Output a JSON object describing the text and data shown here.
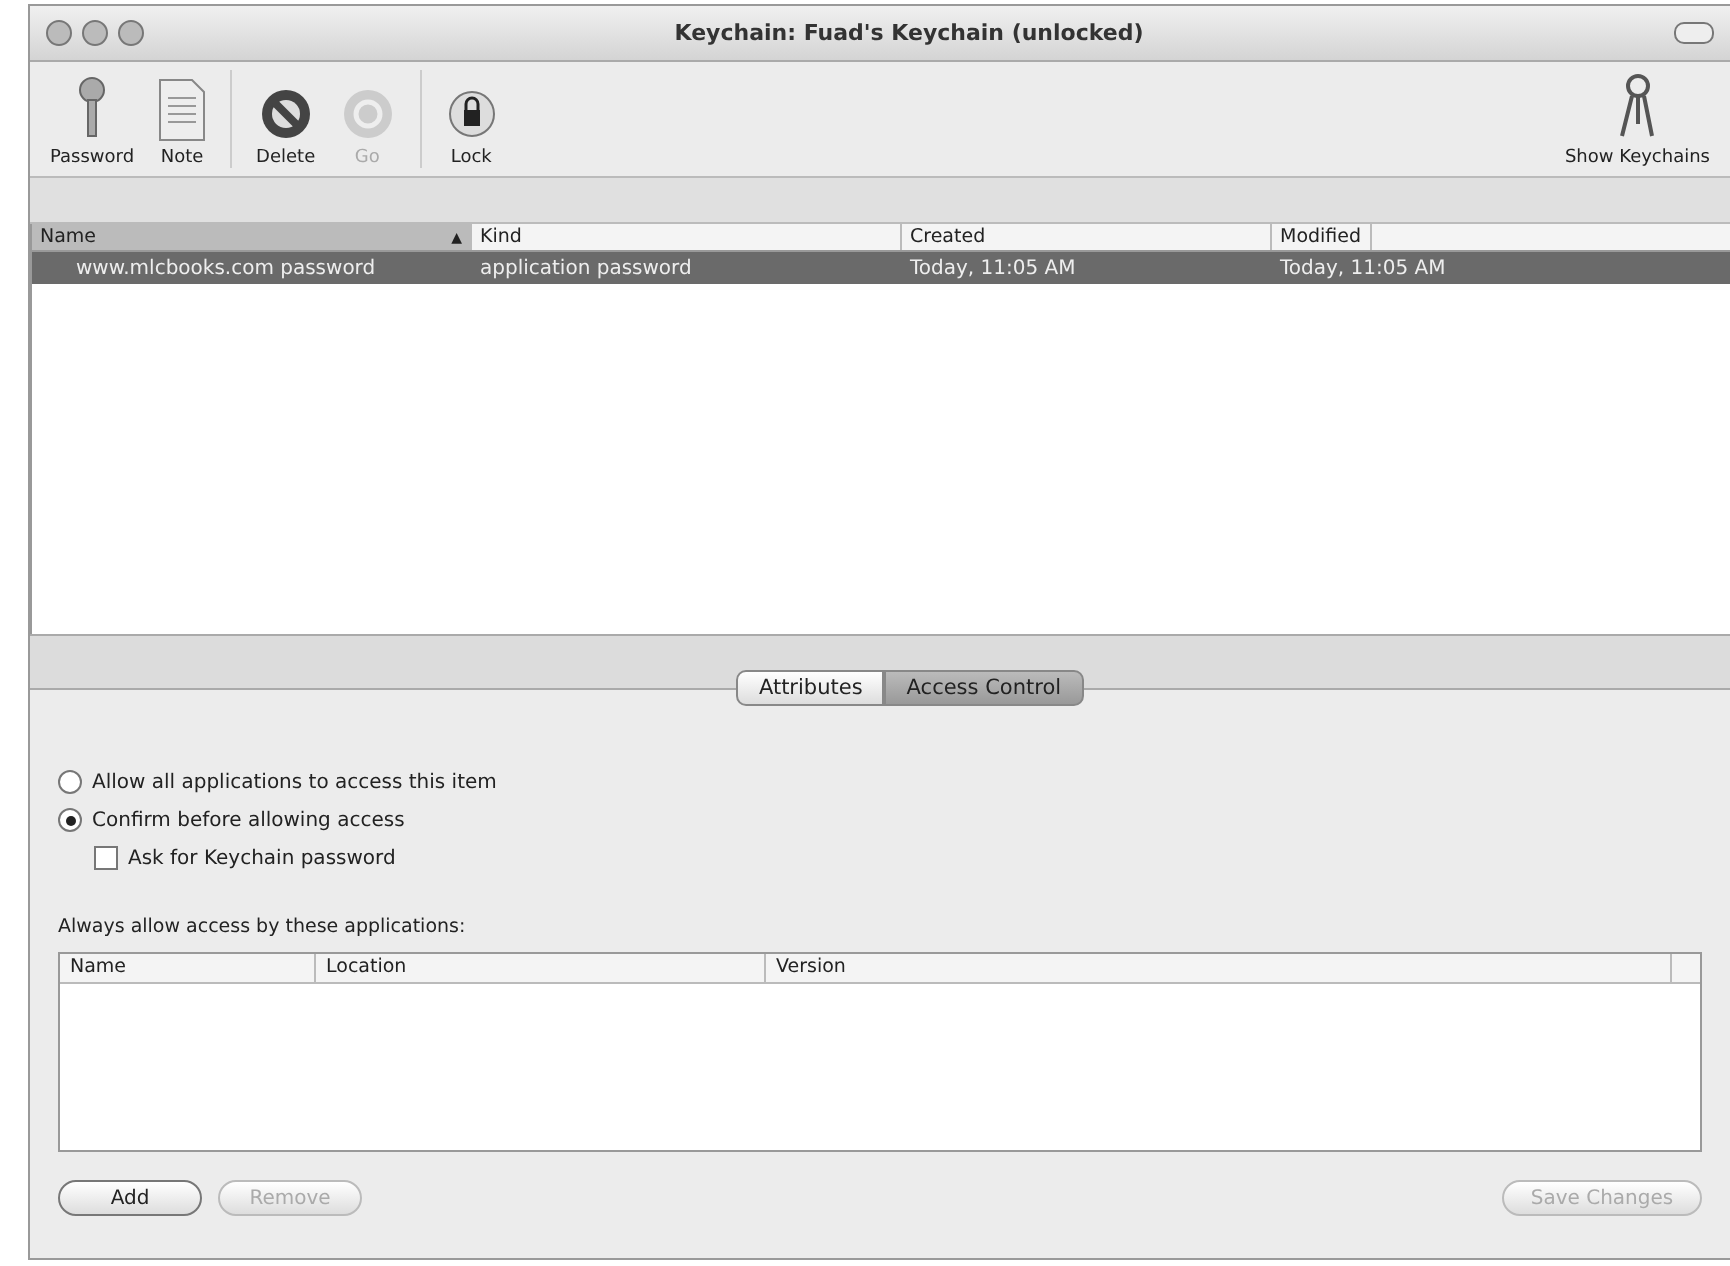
{
  "window": {
    "title": "Keychain: Fuad's Keychain (unlocked)"
  },
  "toolbar": [
    {
      "kind": "password",
      "label": "Password",
      "disabled": false
    },
    {
      "kind": "note",
      "label": "Note",
      "disabled": false
    },
    {
      "kind": "delete",
      "label": "Delete",
      "disabled": false
    },
    {
      "kind": "go",
      "label": "Go",
      "disabled": true
    },
    {
      "kind": "lock",
      "label": "Lock",
      "disabled": false
    },
    {
      "kind": "keychains",
      "label": "Show Keychains",
      "disabled": false
    }
  ],
  "items_table": {
    "columns": [
      {
        "label": "Name",
        "sort": "▲"
      },
      {
        "label": "Kind"
      },
      {
        "label": "Created"
      },
      {
        "label": "Modified"
      }
    ],
    "rows": [
      {
        "selected": true,
        "cells": [
          "www.mlcbooks.com password",
          "application password",
          "Today, 11:05 AM",
          "Today, 11:05 AM"
        ]
      }
    ]
  },
  "tabs": [
    {
      "label": "Attributes",
      "selected": false
    },
    {
      "label": "Access Control",
      "selected": true
    }
  ],
  "access": {
    "options": [
      {
        "kind": "radio",
        "label": "Allow all applications to access this item",
        "checked": false
      },
      {
        "kind": "radio",
        "label": "Confirm before allowing access",
        "checked": true
      },
      {
        "kind": "checkbox",
        "label": "Ask for Keychain password",
        "checked": false
      }
    ],
    "apps_label": "Always allow access by these applications:",
    "apps_columns": [
      "Name",
      "Location",
      "Version"
    ]
  },
  "buttons": [
    {
      "label": "Add",
      "disabled": false
    },
    {
      "label": "Remove",
      "disabled": true
    },
    {
      "label": "Save Changes",
      "disabled": true
    }
  ]
}
